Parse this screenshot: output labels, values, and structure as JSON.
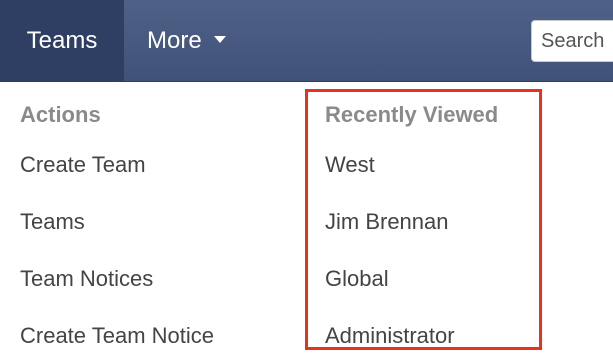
{
  "navbar": {
    "tabs": [
      {
        "label": "Teams",
        "active": true
      },
      {
        "label": "More",
        "has_dropdown": true
      }
    ],
    "search": {
      "placeholder": "Search"
    },
    "colors": {
      "bar": "#44567d",
      "active_tab": "#2e3f63",
      "text": "#ffffff"
    }
  },
  "dropdown": {
    "actions": {
      "heading": "Actions",
      "items": [
        "Create Team",
        "Teams",
        "Team Notices",
        "Create Team Notice"
      ]
    },
    "recently_viewed": {
      "heading": "Recently Viewed",
      "items": [
        "West",
        "Jim Brennan",
        "Global",
        "Administrator"
      ],
      "highlighted": true,
      "highlight_color": "#e8321e"
    }
  }
}
